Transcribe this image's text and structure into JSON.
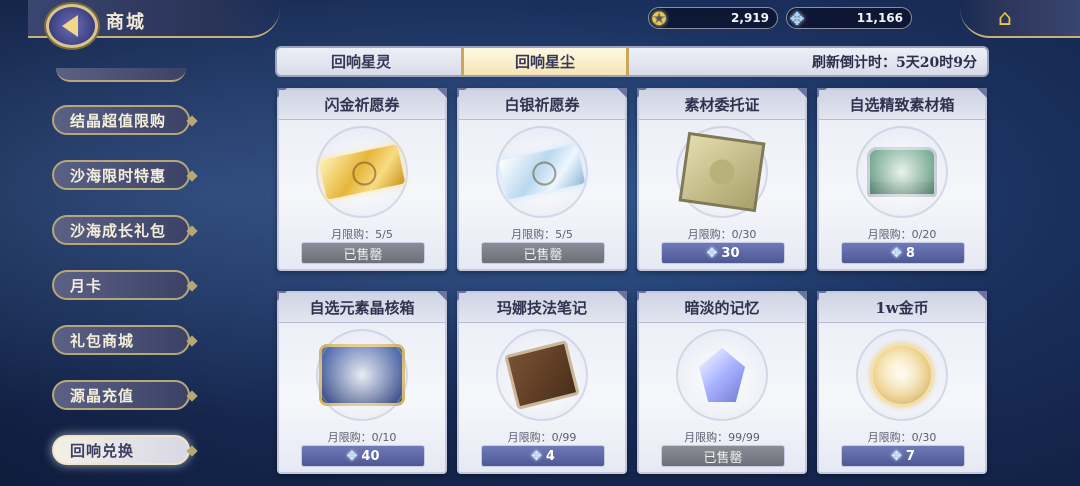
{
  "header": {
    "title": "商城",
    "currency_gold": "2,919",
    "currency_blue": "11,166"
  },
  "sidebar": {
    "items": [
      {
        "label": "结晶超值限购"
      },
      {
        "label": "沙海限时特惠"
      },
      {
        "label": "沙海成长礼包"
      },
      {
        "label": "月卡"
      },
      {
        "label": "礼包商城"
      },
      {
        "label": "源晶充值"
      },
      {
        "label": "回响兑换"
      }
    ],
    "active_index": 6
  },
  "tabs": {
    "items": [
      {
        "label": "回响星灵"
      },
      {
        "label": "回响星尘"
      }
    ],
    "active_index": 1,
    "refresh_text": "刷新倒计时：5天20时9分"
  },
  "items": [
    {
      "name": "闪金祈愿券",
      "limit": "月限购：5/5",
      "price": "已售罄",
      "sold_out": true,
      "icon": "gold-ticket-icon"
    },
    {
      "name": "白银祈愿券",
      "limit": "月限购：5/5",
      "price": "已售罄",
      "sold_out": true,
      "icon": "silver-ticket-icon"
    },
    {
      "name": "素材委托证",
      "limit": "月限购：0/30",
      "price": "30",
      "sold_out": false,
      "icon": "commission-scroll-icon"
    },
    {
      "name": "自选精致素材箱",
      "limit": "月限购：0/20",
      "price": "8",
      "sold_out": false,
      "icon": "green-chest-icon"
    },
    {
      "name": "自选元素晶核箱",
      "limit": "月限购：0/10",
      "price": "40",
      "sold_out": false,
      "icon": "blue-chest-icon"
    },
    {
      "name": "玛娜技法笔记",
      "limit": "月限购：0/99",
      "price": "4",
      "sold_out": false,
      "icon": "book-icon"
    },
    {
      "name": "暗淡的记忆",
      "limit": "月限购：99/99",
      "price": "已售罄",
      "sold_out": true,
      "icon": "crystal-icon"
    },
    {
      "name": "1w金币",
      "limit": "月限购：0/30",
      "price": "7",
      "sold_out": false,
      "icon": "gold-coin-icon"
    }
  ],
  "colors": {
    "accent_gold": "#c9b27a",
    "price_blue": "#4e5894",
    "sold_gray": "#6c6f79"
  }
}
